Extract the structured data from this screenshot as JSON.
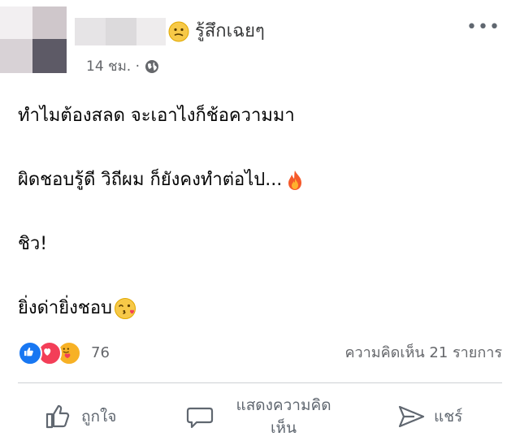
{
  "post": {
    "feeling": "รู้สึกเฉยๆ",
    "feeling_emoji": "neutral-face-icon",
    "timestamp": "14 ชม. ·",
    "privacy_icon": "globe-icon",
    "more_label": "•••",
    "paragraphs": [
      {
        "text": "ทำไมต้องสลด จะเอาไงก็ช้อความมา",
        "emoji": null
      },
      {
        "text": "ผิดชอบรู้ดี วิถีผม ก็ยังคงทำต่อไป...",
        "emoji": "fire-icon"
      },
      {
        "text": "ชิว!",
        "emoji": null
      },
      {
        "text": "ยิ่งด่ายิ่งชอบ",
        "emoji": "kissing-face-icon"
      }
    ]
  },
  "stats": {
    "reactions": [
      "like-reaction-icon",
      "love-reaction-icon",
      "care-reaction-icon"
    ],
    "reaction_count": "76",
    "comment_count_label": "ความคิดเห็น 21 รายการ"
  },
  "actions": {
    "like_label": "ถูกใจ",
    "comment_label_line1": "แสดงความคิด",
    "comment_label_line2": "เห็น",
    "share_label": "แชร์"
  },
  "colors": {
    "like_blue": "#1877f2",
    "love_red": "#f33e58",
    "care_yellow": "#f7b125",
    "muted_text": "#65676b"
  }
}
